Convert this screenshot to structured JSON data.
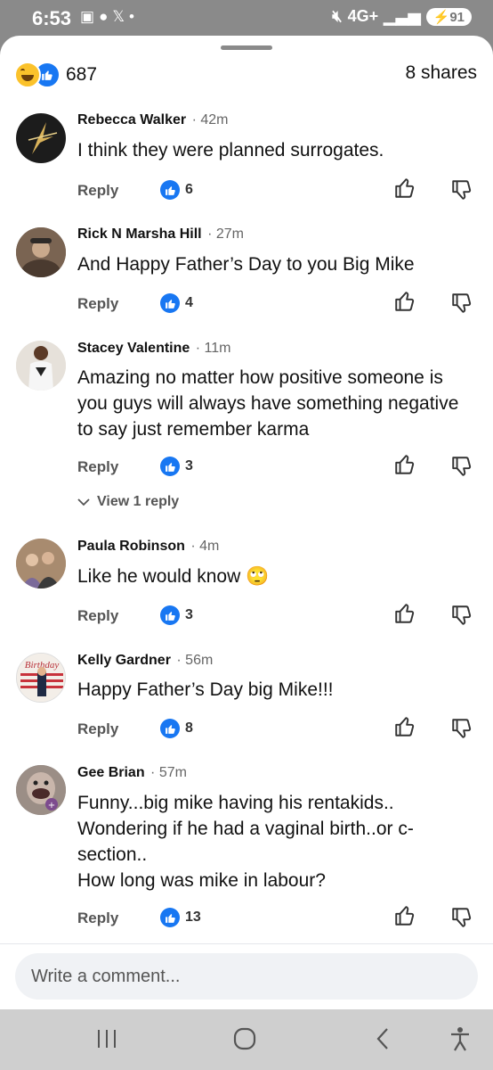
{
  "status_bar": {
    "time": "6:53",
    "network": "4G+",
    "battery": "91"
  },
  "header": {
    "reaction_count": "687",
    "shares": "8 shares"
  },
  "comments": [
    {
      "name": "Rebecca Walker",
      "time": "42m",
      "text": "I think they were planned surrogates.",
      "reply_label": "Reply",
      "likes": "6"
    },
    {
      "name": "Rick N Marsha Hill",
      "time": "27m",
      "text": "And Happy Father’s Day to you Big Mike",
      "reply_label": "Reply",
      "likes": "4"
    },
    {
      "name": "Stacey Valentine",
      "time": "11m",
      "text": "Amazing no matter how positive someone is you guys will always have something negative to say just remember karma",
      "reply_label": "Reply",
      "likes": "3",
      "view_replies": "View 1 reply"
    },
    {
      "name": "Paula Robinson",
      "time": "4m",
      "text": "Like he would know 🙄",
      "reply_label": "Reply",
      "likes": "3"
    },
    {
      "name": "Kelly Gardner",
      "time": "56m",
      "text": "Happy Father’s Day big Mike!!!",
      "reply_label": "Reply",
      "likes": "8",
      "avatar_text": "Birthday"
    },
    {
      "name": "Gee Brian",
      "time": "57m",
      "text": "Funny...big mike having his rentakids..\nWondering if he had a vaginal birth..or c-section..\nHow long was mike in labour?",
      "reply_label": "Reply",
      "likes": "13"
    }
  ],
  "comment_input": {
    "placeholder": "Write a comment..."
  },
  "colors": {
    "facebook_blue": "#1877f2",
    "haha_yellow": "#fbc22b"
  }
}
